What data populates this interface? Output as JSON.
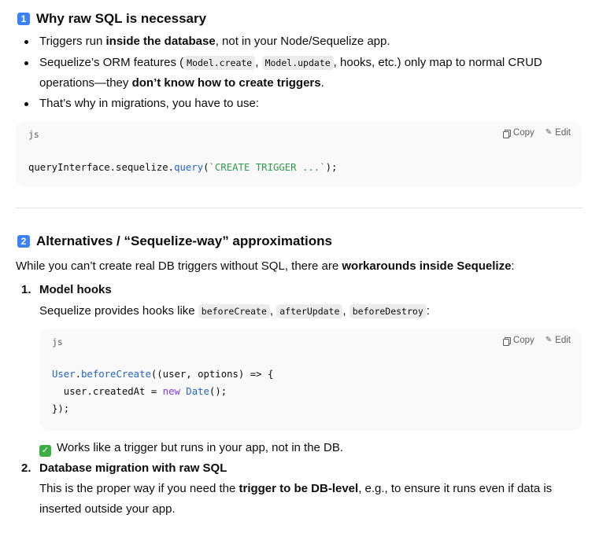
{
  "section1": {
    "badge": "1",
    "title": "Why raw SQL is necessary",
    "bullets": {
      "b1": {
        "pre": "Triggers run ",
        "bold": "inside the database",
        "post": ", not in your Node/Sequelize app."
      },
      "b2": {
        "pre": "Sequelize’s ORM features (",
        "code1": "Model.create",
        "sep": ", ",
        "code2": "Model.update",
        "post": ", hooks, etc.) only map to normal CRUD",
        "line2_pre": "operations—they ",
        "line2_bold": "don’t know how to create triggers",
        "line2_post": "."
      },
      "b3": {
        "text": "That’s why in migrations, you have to use:"
      }
    },
    "code": {
      "lang": "js",
      "copy_label": "Copy",
      "edit_label": "Edit",
      "t1": "queryInterface.sequelize.",
      "t2": "query",
      "t3": "(",
      "t4": "`CREATE TRIGGER ...`",
      "t5": ");"
    }
  },
  "section2": {
    "badge": "2",
    "title": "Alternatives / “Sequelize-way” approximations",
    "intro_pre": "While you can’t create real DB triggers without SQL, there are ",
    "intro_bold": "workarounds inside Sequelize",
    "intro_post": ":",
    "item1": {
      "num": "1.",
      "title": "Model hooks",
      "desc_pre": "Sequelize provides hooks like ",
      "c1": "beforeCreate",
      "c2": "afterUpdate",
      "c3": "beforeDestroy",
      "sep": ", ",
      "desc_post": ":",
      "code": {
        "lang": "js",
        "copy_label": "Copy",
        "edit_label": "Edit",
        "l1a": "User",
        "l1b": ".",
        "l1c": "beforeCreate",
        "l1d": "((user, options) => {",
        "l2a": "  user.createdAt = ",
        "l2b": "new",
        "l2c": " ",
        "l2d": "Date",
        "l2e": "();",
        "l3": "});"
      },
      "check_text": "Works like a trigger but runs in your app, not in the DB."
    },
    "item2": {
      "num": "2.",
      "title": "Database migration with raw SQL",
      "desc_pre": "This is the proper way if you need the ",
      "desc_bold": "trigger to be DB-level",
      "desc_post": ", e.g., to ensure it runs even if data is",
      "desc_line2": "inserted outside your app."
    }
  }
}
